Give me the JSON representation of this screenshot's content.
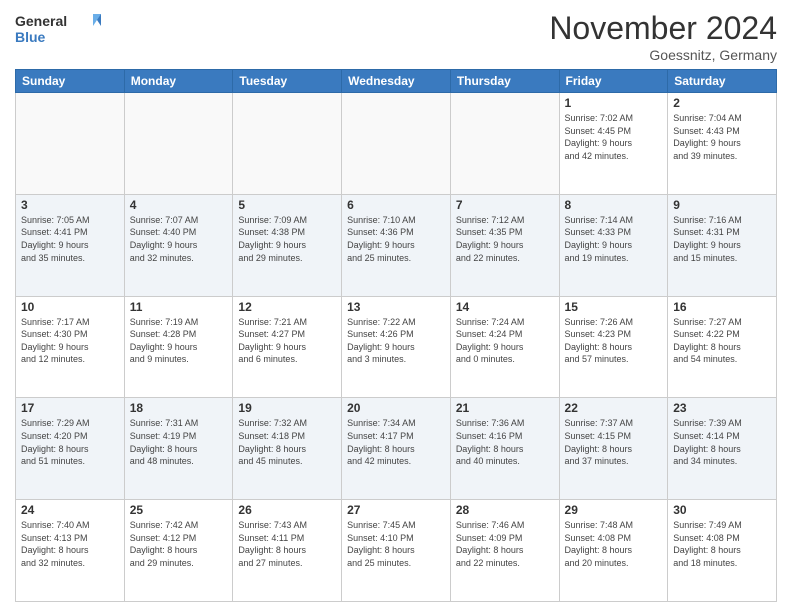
{
  "logo": {
    "general": "General",
    "blue": "Blue"
  },
  "title": "November 2024",
  "location": "Goessnitz, Germany",
  "weekdays": [
    "Sunday",
    "Monday",
    "Tuesday",
    "Wednesday",
    "Thursday",
    "Friday",
    "Saturday"
  ],
  "weeks": [
    [
      {
        "day": "",
        "info": ""
      },
      {
        "day": "",
        "info": ""
      },
      {
        "day": "",
        "info": ""
      },
      {
        "day": "",
        "info": ""
      },
      {
        "day": "",
        "info": ""
      },
      {
        "day": "1",
        "info": "Sunrise: 7:02 AM\nSunset: 4:45 PM\nDaylight: 9 hours\nand 42 minutes."
      },
      {
        "day": "2",
        "info": "Sunrise: 7:04 AM\nSunset: 4:43 PM\nDaylight: 9 hours\nand 39 minutes."
      }
    ],
    [
      {
        "day": "3",
        "info": "Sunrise: 7:05 AM\nSunset: 4:41 PM\nDaylight: 9 hours\nand 35 minutes."
      },
      {
        "day": "4",
        "info": "Sunrise: 7:07 AM\nSunset: 4:40 PM\nDaylight: 9 hours\nand 32 minutes."
      },
      {
        "day": "5",
        "info": "Sunrise: 7:09 AM\nSunset: 4:38 PM\nDaylight: 9 hours\nand 29 minutes."
      },
      {
        "day": "6",
        "info": "Sunrise: 7:10 AM\nSunset: 4:36 PM\nDaylight: 9 hours\nand 25 minutes."
      },
      {
        "day": "7",
        "info": "Sunrise: 7:12 AM\nSunset: 4:35 PM\nDaylight: 9 hours\nand 22 minutes."
      },
      {
        "day": "8",
        "info": "Sunrise: 7:14 AM\nSunset: 4:33 PM\nDaylight: 9 hours\nand 19 minutes."
      },
      {
        "day": "9",
        "info": "Sunrise: 7:16 AM\nSunset: 4:31 PM\nDaylight: 9 hours\nand 15 minutes."
      }
    ],
    [
      {
        "day": "10",
        "info": "Sunrise: 7:17 AM\nSunset: 4:30 PM\nDaylight: 9 hours\nand 12 minutes."
      },
      {
        "day": "11",
        "info": "Sunrise: 7:19 AM\nSunset: 4:28 PM\nDaylight: 9 hours\nand 9 minutes."
      },
      {
        "day": "12",
        "info": "Sunrise: 7:21 AM\nSunset: 4:27 PM\nDaylight: 9 hours\nand 6 minutes."
      },
      {
        "day": "13",
        "info": "Sunrise: 7:22 AM\nSunset: 4:26 PM\nDaylight: 9 hours\nand 3 minutes."
      },
      {
        "day": "14",
        "info": "Sunrise: 7:24 AM\nSunset: 4:24 PM\nDaylight: 9 hours\nand 0 minutes."
      },
      {
        "day": "15",
        "info": "Sunrise: 7:26 AM\nSunset: 4:23 PM\nDaylight: 8 hours\nand 57 minutes."
      },
      {
        "day": "16",
        "info": "Sunrise: 7:27 AM\nSunset: 4:22 PM\nDaylight: 8 hours\nand 54 minutes."
      }
    ],
    [
      {
        "day": "17",
        "info": "Sunrise: 7:29 AM\nSunset: 4:20 PM\nDaylight: 8 hours\nand 51 minutes."
      },
      {
        "day": "18",
        "info": "Sunrise: 7:31 AM\nSunset: 4:19 PM\nDaylight: 8 hours\nand 48 minutes."
      },
      {
        "day": "19",
        "info": "Sunrise: 7:32 AM\nSunset: 4:18 PM\nDaylight: 8 hours\nand 45 minutes."
      },
      {
        "day": "20",
        "info": "Sunrise: 7:34 AM\nSunset: 4:17 PM\nDaylight: 8 hours\nand 42 minutes."
      },
      {
        "day": "21",
        "info": "Sunrise: 7:36 AM\nSunset: 4:16 PM\nDaylight: 8 hours\nand 40 minutes."
      },
      {
        "day": "22",
        "info": "Sunrise: 7:37 AM\nSunset: 4:15 PM\nDaylight: 8 hours\nand 37 minutes."
      },
      {
        "day": "23",
        "info": "Sunrise: 7:39 AM\nSunset: 4:14 PM\nDaylight: 8 hours\nand 34 minutes."
      }
    ],
    [
      {
        "day": "24",
        "info": "Sunrise: 7:40 AM\nSunset: 4:13 PM\nDaylight: 8 hours\nand 32 minutes."
      },
      {
        "day": "25",
        "info": "Sunrise: 7:42 AM\nSunset: 4:12 PM\nDaylight: 8 hours\nand 29 minutes."
      },
      {
        "day": "26",
        "info": "Sunrise: 7:43 AM\nSunset: 4:11 PM\nDaylight: 8 hours\nand 27 minutes."
      },
      {
        "day": "27",
        "info": "Sunrise: 7:45 AM\nSunset: 4:10 PM\nDaylight: 8 hours\nand 25 minutes."
      },
      {
        "day": "28",
        "info": "Sunrise: 7:46 AM\nSunset: 4:09 PM\nDaylight: 8 hours\nand 22 minutes."
      },
      {
        "day": "29",
        "info": "Sunrise: 7:48 AM\nSunset: 4:08 PM\nDaylight: 8 hours\nand 20 minutes."
      },
      {
        "day": "30",
        "info": "Sunrise: 7:49 AM\nSunset: 4:08 PM\nDaylight: 8 hours\nand 18 minutes."
      }
    ]
  ]
}
